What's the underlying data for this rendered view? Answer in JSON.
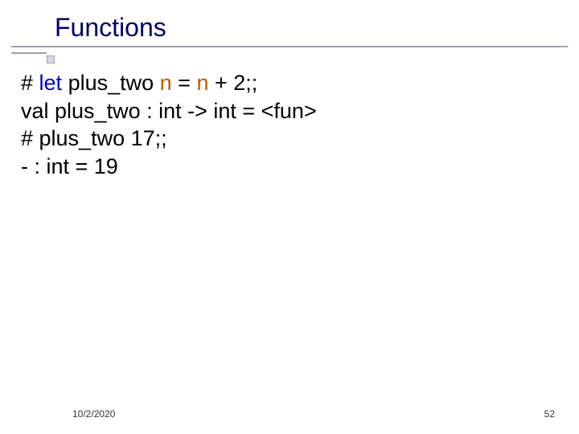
{
  "title": "Functions",
  "code": {
    "l1_pre": "# ",
    "l1_let": "let",
    "l1_mid1": " plus_two ",
    "l1_n1": "n",
    "l1_eq": " = ",
    "l1_n2": "n",
    "l1_post": " + 2;;",
    "l2": "val plus_two : int -> int = <fun>",
    "l3": "# plus_two 17;;",
    "l4": "- : int = 19"
  },
  "footer": {
    "date": "10/2/2020",
    "page": "52"
  }
}
